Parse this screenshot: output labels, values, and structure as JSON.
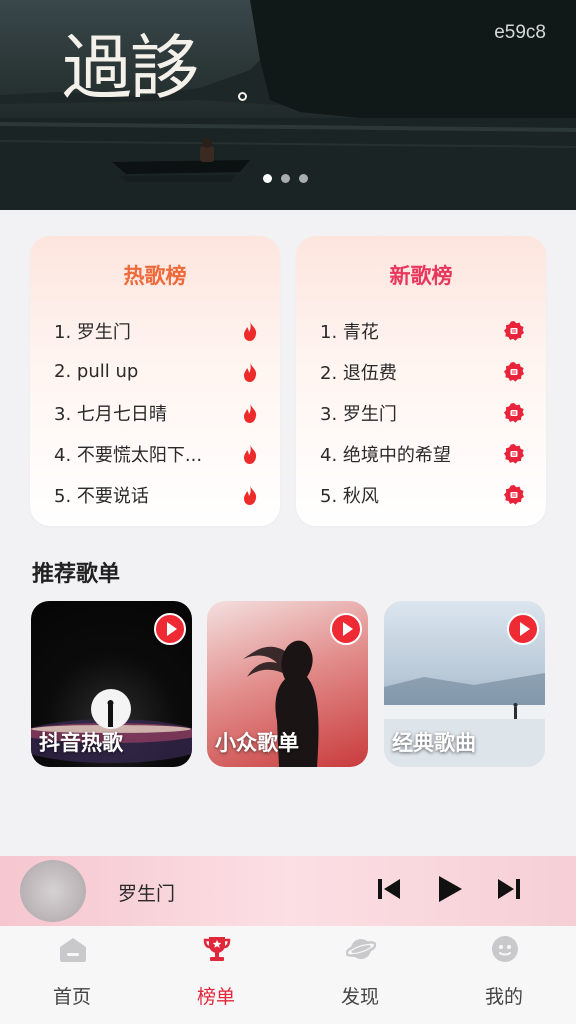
{
  "banner": {
    "title": "過誃",
    "code": "e59c8",
    "page_count": 3,
    "active_page": 1
  },
  "hot_chart": {
    "title": "热歌榜",
    "items": [
      "1. 罗生门",
      "2. pull up",
      "3. 七月七日晴",
      "4. 不要慌太阳下...",
      "5. 不要说话"
    ],
    "icon": "flame-icon"
  },
  "new_chart": {
    "title": "新歌榜",
    "items": [
      "1. 青花",
      "2. 退伍费",
      "3. 罗生门",
      "4. 绝境中的希望",
      "5. 秋风"
    ],
    "icon": "new-badge-icon"
  },
  "recommend": {
    "title": "推荐歌单",
    "playlists": [
      {
        "label": "抖音热歌"
      },
      {
        "label": "小众歌单"
      },
      {
        "label": "经典歌曲"
      }
    ]
  },
  "player": {
    "song": "罗生门"
  },
  "nav": {
    "items": [
      {
        "label": "首页",
        "icon": "home-icon"
      },
      {
        "label": "榜单",
        "icon": "trophy-icon"
      },
      {
        "label": "发现",
        "icon": "planet-icon"
      },
      {
        "label": "我的",
        "icon": "user-face-icon"
      }
    ],
    "active": "榜单"
  },
  "colors": {
    "accent": "#e0283a",
    "hot_title": "#ef6a3b",
    "new_title": "#e8375c",
    "play_badge": "#ee2b34"
  }
}
